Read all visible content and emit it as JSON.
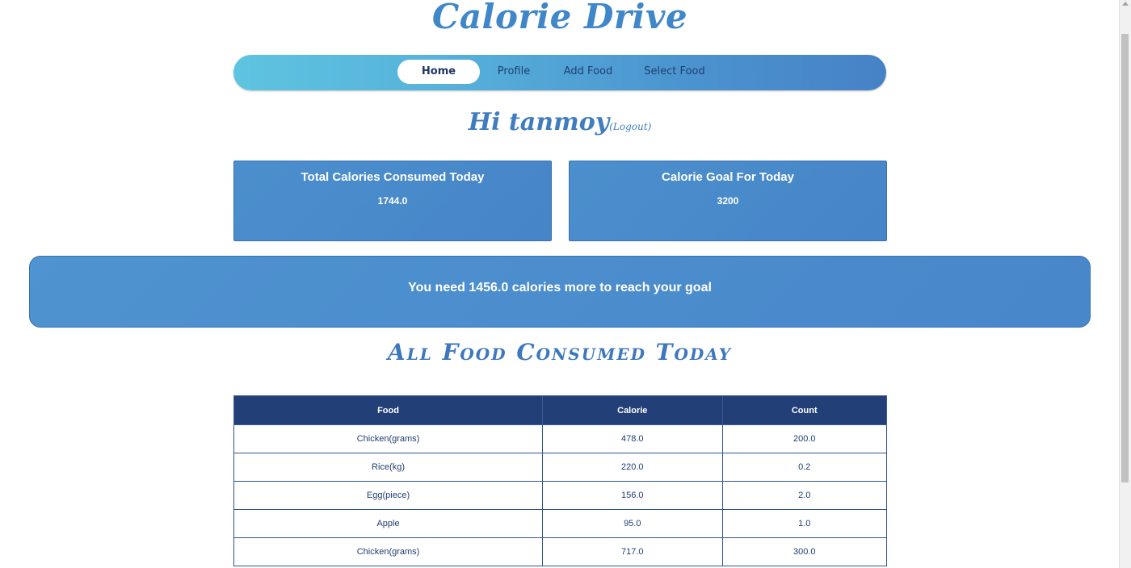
{
  "brand": "Calorie Drive",
  "nav": {
    "home": "Home",
    "profile": "Profile",
    "add_food": "Add Food",
    "select_food": "Select Food"
  },
  "greeting": {
    "hi": "Hi tanmoy",
    "logout": "(Logout)"
  },
  "cards": {
    "consumed_title": "Total Calories Consumed Today",
    "consumed_value": "1744.0",
    "goal_title": "Calorie Goal For Today",
    "goal_value": "3200"
  },
  "banner": "You need 1456.0 calories more to reach your goal",
  "section_title": "All Food Consumed Today",
  "table": {
    "headers": [
      "Food",
      "Calorie",
      "Count"
    ],
    "rows": [
      [
        "Chicken(grams)",
        "478.0",
        "200.0"
      ],
      [
        "Rice(kg)",
        "220.0",
        "0.2"
      ],
      [
        "Egg(piece)",
        "156.0",
        "2.0"
      ],
      [
        "Apple",
        "95.0",
        "1.0"
      ],
      [
        "Chicken(grams)",
        "717.0",
        "300.0"
      ]
    ]
  },
  "colors": {
    "brand": "#3f87c8",
    "card": "#4685c8",
    "table_header": "#233f78"
  }
}
